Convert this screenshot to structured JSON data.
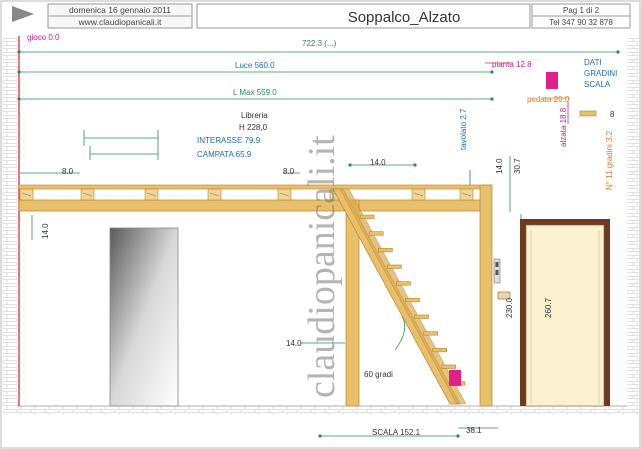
{
  "header": {
    "date": "domenica 16 gennaio 2011",
    "website": "www.claudiopanicali.it",
    "title": "Soppalco_Alzato",
    "page": "Pag 1 di 2",
    "phone": "Tel 347 90 32 878"
  },
  "watermark": "claudiopanicali.it",
  "dimensions": {
    "gioco": "gioco 0.0",
    "total_width": "722.3 (...)",
    "luce": "Luce 560.0",
    "pianta": "pianta 12.8",
    "lmax": "L Max 559.0",
    "libreria": "Libreria",
    "libreria_h": "H 228,0",
    "interasse": "INTERASSE 79.9",
    "campata": "CAMPATA 65.9",
    "tavolato": "tavolato 2.7",
    "left_8": "8.0",
    "mid_8": "8.0",
    "stair_14": "14.0",
    "right_14": "14.0",
    "right_30": "30.7",
    "left_14": "14.0",
    "post_14": "14.0",
    "door_260": "260.7",
    "door_230": "230.0",
    "angle": "60 gradi",
    "scala": "SCALA 152.1",
    "scala_38": "38.1"
  },
  "stair_data": {
    "title": "DATI GRADINI SCALA",
    "pedata": "pedata 20.0",
    "alzata": "alzata 18.8",
    "gradini": "N° 11 gradini 3.2",
    "b": "8"
  },
  "colors": {
    "dim_green": "#2e8b57",
    "dim_blue": "#1f6fb5",
    "dim_magenta": "#d21f8c",
    "dim_orange": "#e07b1a",
    "wood": "#e8bf6a",
    "wood_edge": "#b8862e",
    "door_frame": "#6b3a1f",
    "door_panel": "#fbf0cf"
  },
  "counts": {
    "beams": 8,
    "steps": 11
  }
}
